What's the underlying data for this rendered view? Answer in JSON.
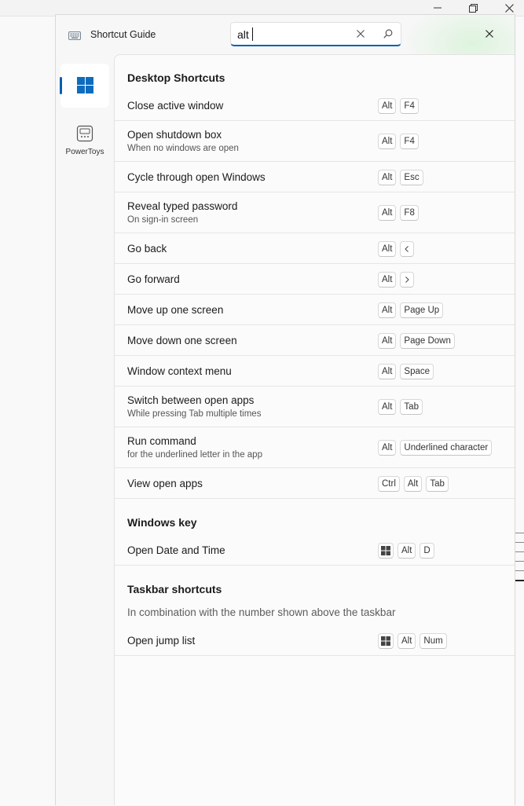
{
  "app": {
    "title": "Shortcut Guide",
    "icon": "keyboard-icon"
  },
  "search": {
    "value": "alt",
    "placeholder": ""
  },
  "nav": [
    {
      "label": "",
      "icon": "windows-icon",
      "selected": true
    },
    {
      "label": "PowerToys",
      "icon": "powertoys-icon",
      "selected": false
    }
  ],
  "sections": [
    {
      "title": "Desktop Shortcuts",
      "rows": [
        {
          "name": "Close active window",
          "desc": "",
          "keys": [
            "Alt",
            "F4"
          ]
        },
        {
          "name": "Open shutdown box",
          "desc": "When no windows are open",
          "keys": [
            "Alt",
            "F4"
          ]
        },
        {
          "name": "Cycle through open Windows",
          "desc": "",
          "keys": [
            "Alt",
            "Esc"
          ]
        },
        {
          "name": "Reveal typed password",
          "desc": "On sign-in screen",
          "keys": [
            "Alt",
            "F8"
          ]
        },
        {
          "name": "Go back",
          "desc": "",
          "keys": [
            "Alt",
            "<"
          ]
        },
        {
          "name": "Go forward",
          "desc": "",
          "keys": [
            "Alt",
            ">"
          ]
        },
        {
          "name": "Move up one screen",
          "desc": "",
          "keys": [
            "Alt",
            "Page Up"
          ]
        },
        {
          "name": "Move down one screen",
          "desc": "",
          "keys": [
            "Alt",
            "Page Down"
          ]
        },
        {
          "name": "Window context menu",
          "desc": "",
          "keys": [
            "Alt",
            "Space"
          ]
        },
        {
          "name": "Switch between open apps",
          "desc": "While pressing Tab multiple times",
          "keys": [
            "Alt",
            "Tab"
          ]
        },
        {
          "name": "Run command",
          "desc": "for the underlined letter in the app",
          "keys": [
            "Alt",
            "Underlined character"
          ]
        },
        {
          "name": "View open apps",
          "desc": "",
          "keys": [
            "Ctrl",
            "Alt",
            "Tab"
          ]
        }
      ]
    },
    {
      "title": "Windows key",
      "rows": [
        {
          "name": "Open Date and Time",
          "desc": "",
          "keys": [
            "Win",
            "Alt",
            "D"
          ]
        }
      ]
    },
    {
      "title": "Taskbar shortcuts",
      "subtitle": "In combination with the number shown above the taskbar",
      "rows": [
        {
          "name": "Open jump list",
          "desc": "",
          "keys": [
            "Win",
            "Alt",
            "Num"
          ]
        }
      ]
    }
  ],
  "colors": {
    "accent": "#005fb8",
    "windows_logo": "#0f6cbd"
  }
}
